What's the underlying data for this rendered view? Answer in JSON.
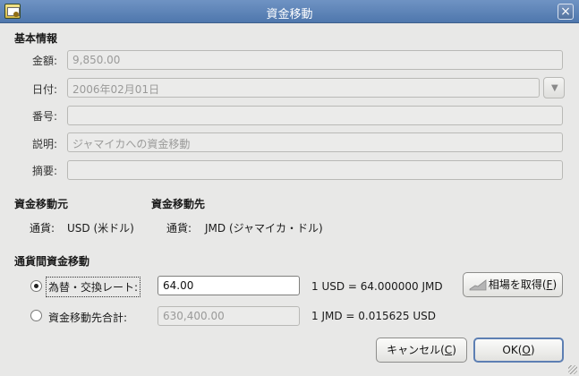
{
  "window": {
    "title": "資金移動",
    "close_glyph": "×"
  },
  "basic": {
    "section_title": "基本情報",
    "amount_label": "金額:",
    "amount_value": "9,850.00",
    "date_label": "日付:",
    "date_value": "2006年02月01日",
    "number_label": "番号:",
    "number_value": "",
    "description_label": "説明:",
    "description_value": "ジャマイカへの資金移動",
    "memo_label": "摘要:",
    "memo_value": ""
  },
  "transfer_from": {
    "title": "資金移動元",
    "currency_label": "通貨:",
    "currency_value": "USD (米ドル)"
  },
  "transfer_to": {
    "title": "資金移動先",
    "currency_label": "通貨:",
    "currency_value": "JMD (ジャマイカ・ドル)"
  },
  "exchange": {
    "title": "通貨間資金移動",
    "rate_radio_label": "為替・交換レート:",
    "rate_value": "64.00",
    "rate_info": "1 USD = 64.000000 JMD",
    "fetch_button_label": "相場を取得(",
    "fetch_button_mnemonic": "F",
    "fetch_button_suffix": ")",
    "total_radio_label": "資金移動先合計:",
    "total_value": "630,400.00",
    "reverse_info": "1 JMD = 0.015625 USD"
  },
  "actions": {
    "cancel_label": "キャンセル(",
    "cancel_mnemonic": "C",
    "cancel_suffix": ")",
    "ok_label": "OK(",
    "ok_mnemonic": "O",
    "ok_suffix": ")"
  },
  "icons": [
    "app-icon",
    "close-icon",
    "chevron-down-icon",
    "stock-chart-icon"
  ],
  "colors": {
    "title_bar": "#5b82b6",
    "dialog_bg": "#e8e8e7",
    "default_border": "#5d7fb3"
  }
}
